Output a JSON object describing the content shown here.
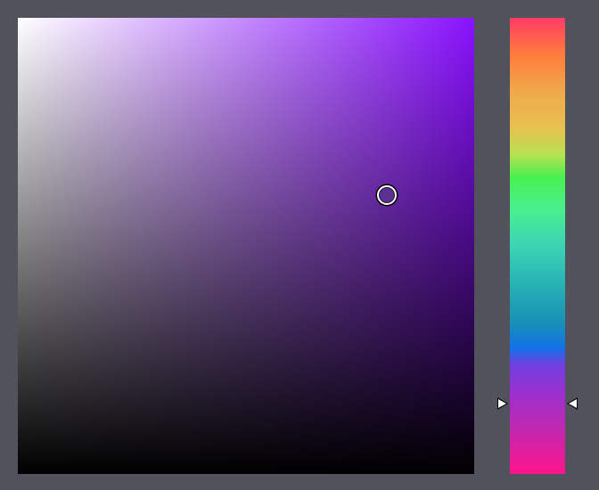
{
  "picker": {
    "hue_base_color": "#8a12ff",
    "selected_color": "#5a3190",
    "saturation": 0.81,
    "value": 0.61,
    "hue_position": 0.845
  }
}
